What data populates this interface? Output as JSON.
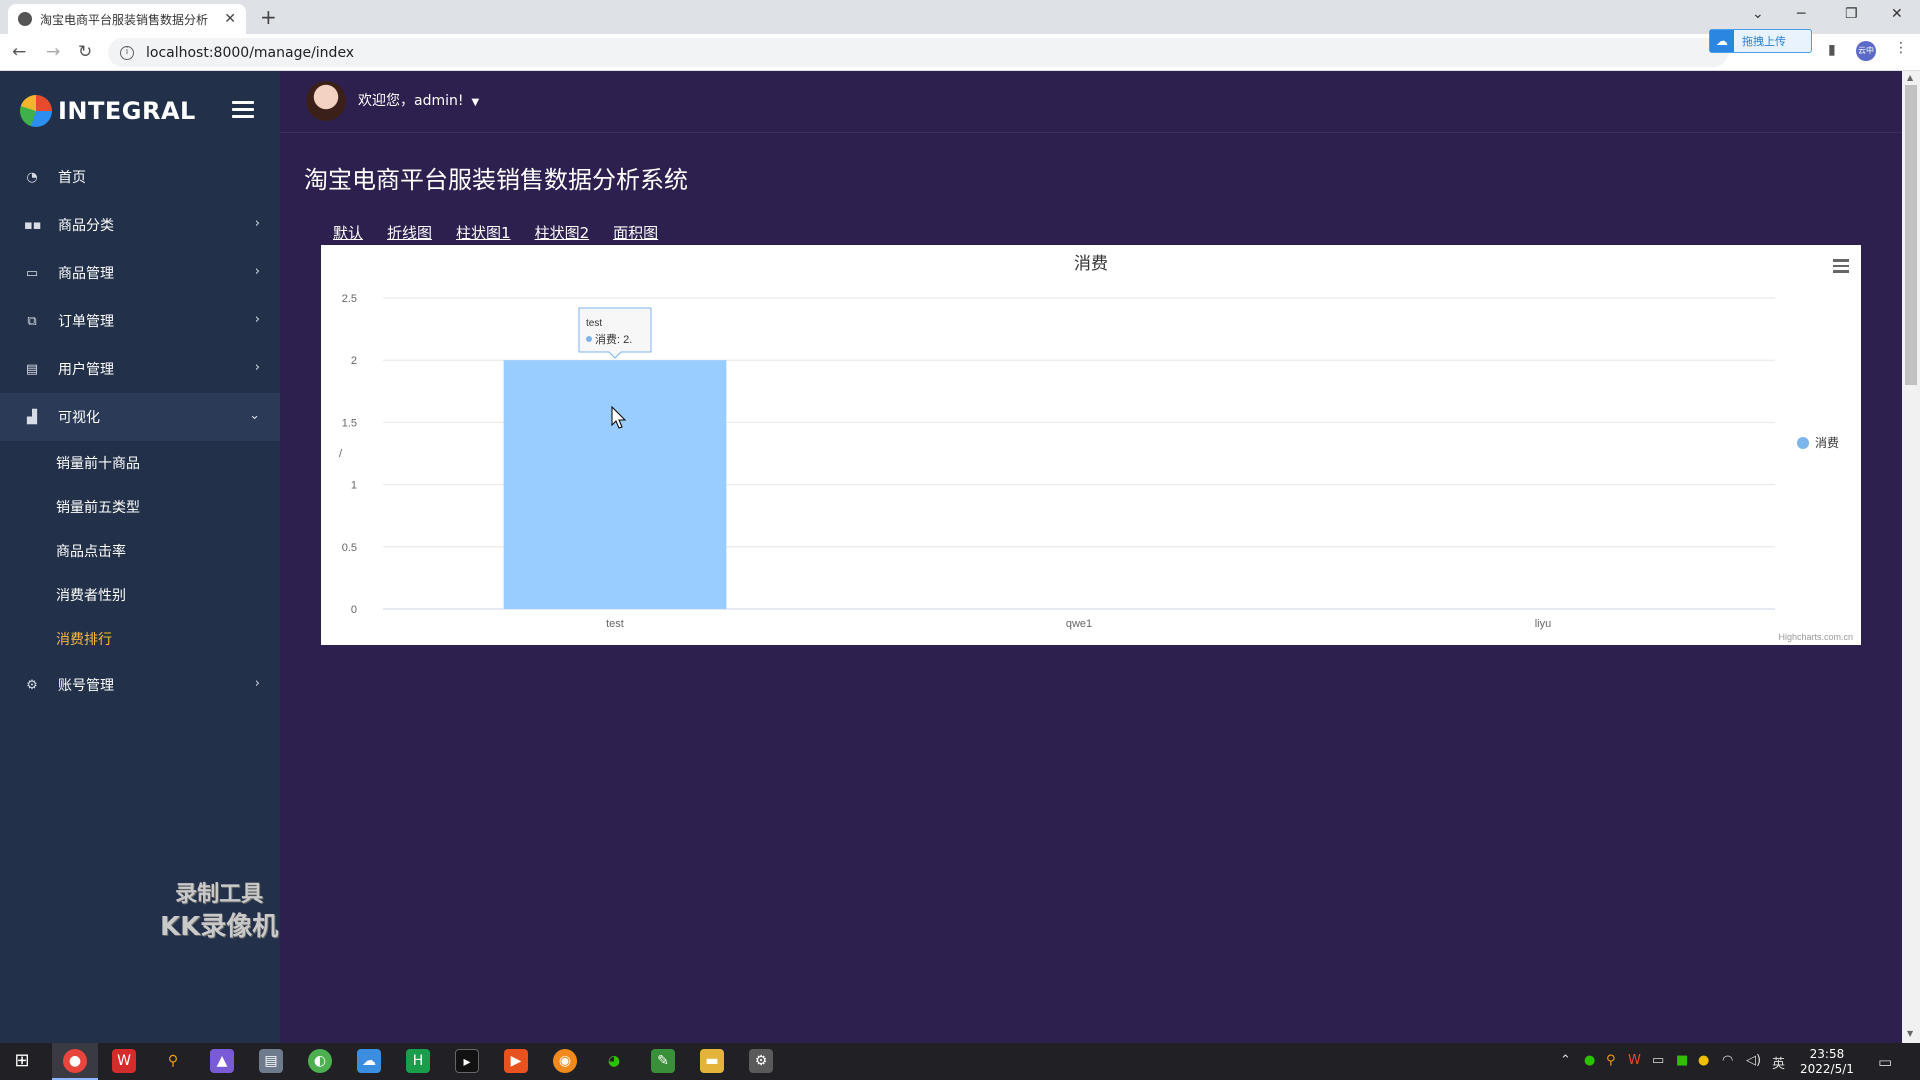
{
  "browser": {
    "tab_title": "淘宝电商平台服装销售数据分析",
    "url": "localhost:8000/manage/index",
    "upload_label": "拖拽上传",
    "profile_label": "云中"
  },
  "sidebar": {
    "brand": "INTEGRAL",
    "items": [
      {
        "label": "首页",
        "icon": "dashboard-icon"
      },
      {
        "label": "商品分类",
        "icon": "grid-icon"
      },
      {
        "label": "商品管理",
        "icon": "window-icon"
      },
      {
        "label": "订单管理",
        "icon": "link-icon"
      },
      {
        "label": "用户管理",
        "icon": "document-icon"
      },
      {
        "label": "可视化",
        "icon": "bar-chart-icon"
      },
      {
        "label": "账号管理",
        "icon": "account-icon"
      }
    ],
    "sub_items": [
      "销量前十商品",
      "销量前五类型",
      "商品点击率",
      "消费者性别",
      "消费排行"
    ],
    "watermark_line1": "录制工具",
    "watermark_line2": "KK录像机"
  },
  "header": {
    "welcome": "欢迎您，admin!"
  },
  "main": {
    "title": "淘宝电商平台服装销售数据分析系统",
    "tabs": [
      "默认",
      "折线图",
      "柱状图1",
      "柱状图2",
      "面积图"
    ]
  },
  "chart_data": {
    "type": "bar",
    "title": "消费",
    "categories": [
      "test",
      "qwe1",
      "liyu"
    ],
    "series": [
      {
        "name": "消费",
        "values": [
          2,
          0,
          0
        ],
        "color": "#99ccff"
      }
    ],
    "ylim": [
      0,
      2.5
    ],
    "yticks": [
      "0",
      "0.5",
      "1",
      "1.5",
      "2",
      "2.5"
    ],
    "ylabel": "/",
    "grid": true,
    "legend": "right",
    "credits": "Highcharts.com.cn",
    "tooltip": {
      "category": "test",
      "text": "消费: 2."
    }
  },
  "taskbar": {
    "ime": "英",
    "time": "23:58",
    "date": "2022/5/1"
  }
}
